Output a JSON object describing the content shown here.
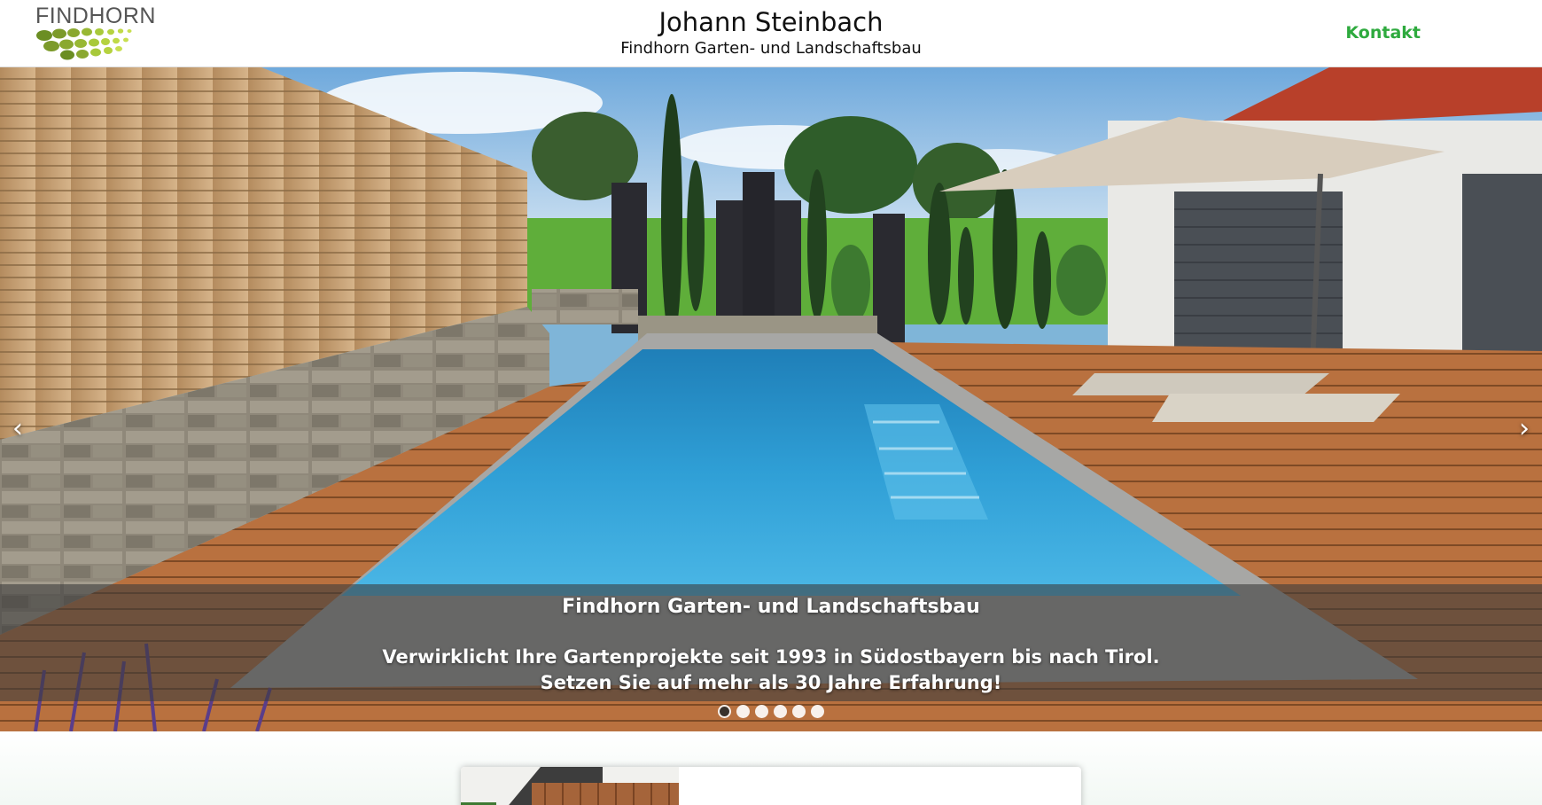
{
  "header": {
    "logo_text": "FINDHORN",
    "title": "Johann Steinbach",
    "subtitle": "Findhorn Garten- und Landschaftsbau",
    "contact_label": "Kontakt"
  },
  "carousel": {
    "caption_title": "Findhorn Garten- und Landschaftsbau",
    "caption_line1": "Verwirklicht Ihre Gartenprojekte seit 1993 in Südostbayern bis nach Tirol.",
    "caption_line2": "Setzen Sie auf mehr als 30 Jahre Erfahrung!",
    "prev_icon": "‹",
    "next_icon": "›",
    "slide_count": 6,
    "active_slide": 1
  },
  "colors": {
    "brand_green": "#2eaa3e",
    "logo_green_dark": "#6b8e23",
    "logo_green_light": "#a8c93a"
  }
}
